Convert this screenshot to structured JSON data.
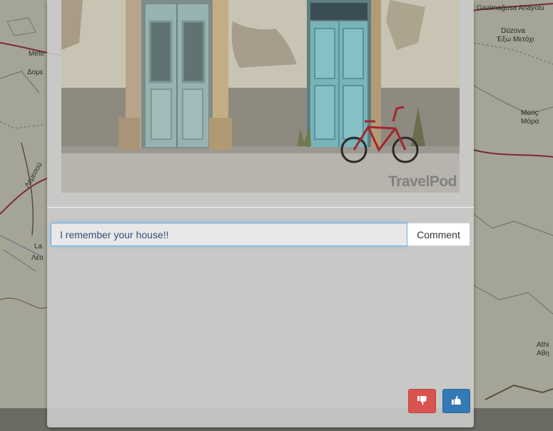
{
  "map": {
    "labels": [
      {
        "id": "famagusta",
        "text": "Gazimağusa Anayolu"
      },
      {
        "id": "duzova",
        "text": "Düzova"
      },
      {
        "id": "exo-metochi",
        "text": "Έξω Μετόχι"
      },
      {
        "id": "meric",
        "text": "Meriç"
      },
      {
        "id": "mora",
        "text": "Μόρα"
      },
      {
        "id": "athi",
        "text": "Athi"
      },
      {
        "id": "athi-gr",
        "text": "Αθη"
      },
      {
        "id": "mete",
        "text": "Mete"
      },
      {
        "id": "dome",
        "text": "Δομε"
      },
      {
        "id": "la",
        "text": "La"
      },
      {
        "id": "lef",
        "text": "Λευ"
      },
      {
        "id": "road",
        "text": "Λεμεσού"
      }
    ]
  },
  "photo": {
    "watermark": "TravelPod"
  },
  "comment": {
    "value": "I remember your house!!",
    "button_label": "Comment"
  },
  "votes": {
    "dislike_icon": "thumbs-down-icon",
    "like_icon": "thumbs-up-icon",
    "dislike_color": "#d9534f",
    "like_color": "#337ab7"
  }
}
